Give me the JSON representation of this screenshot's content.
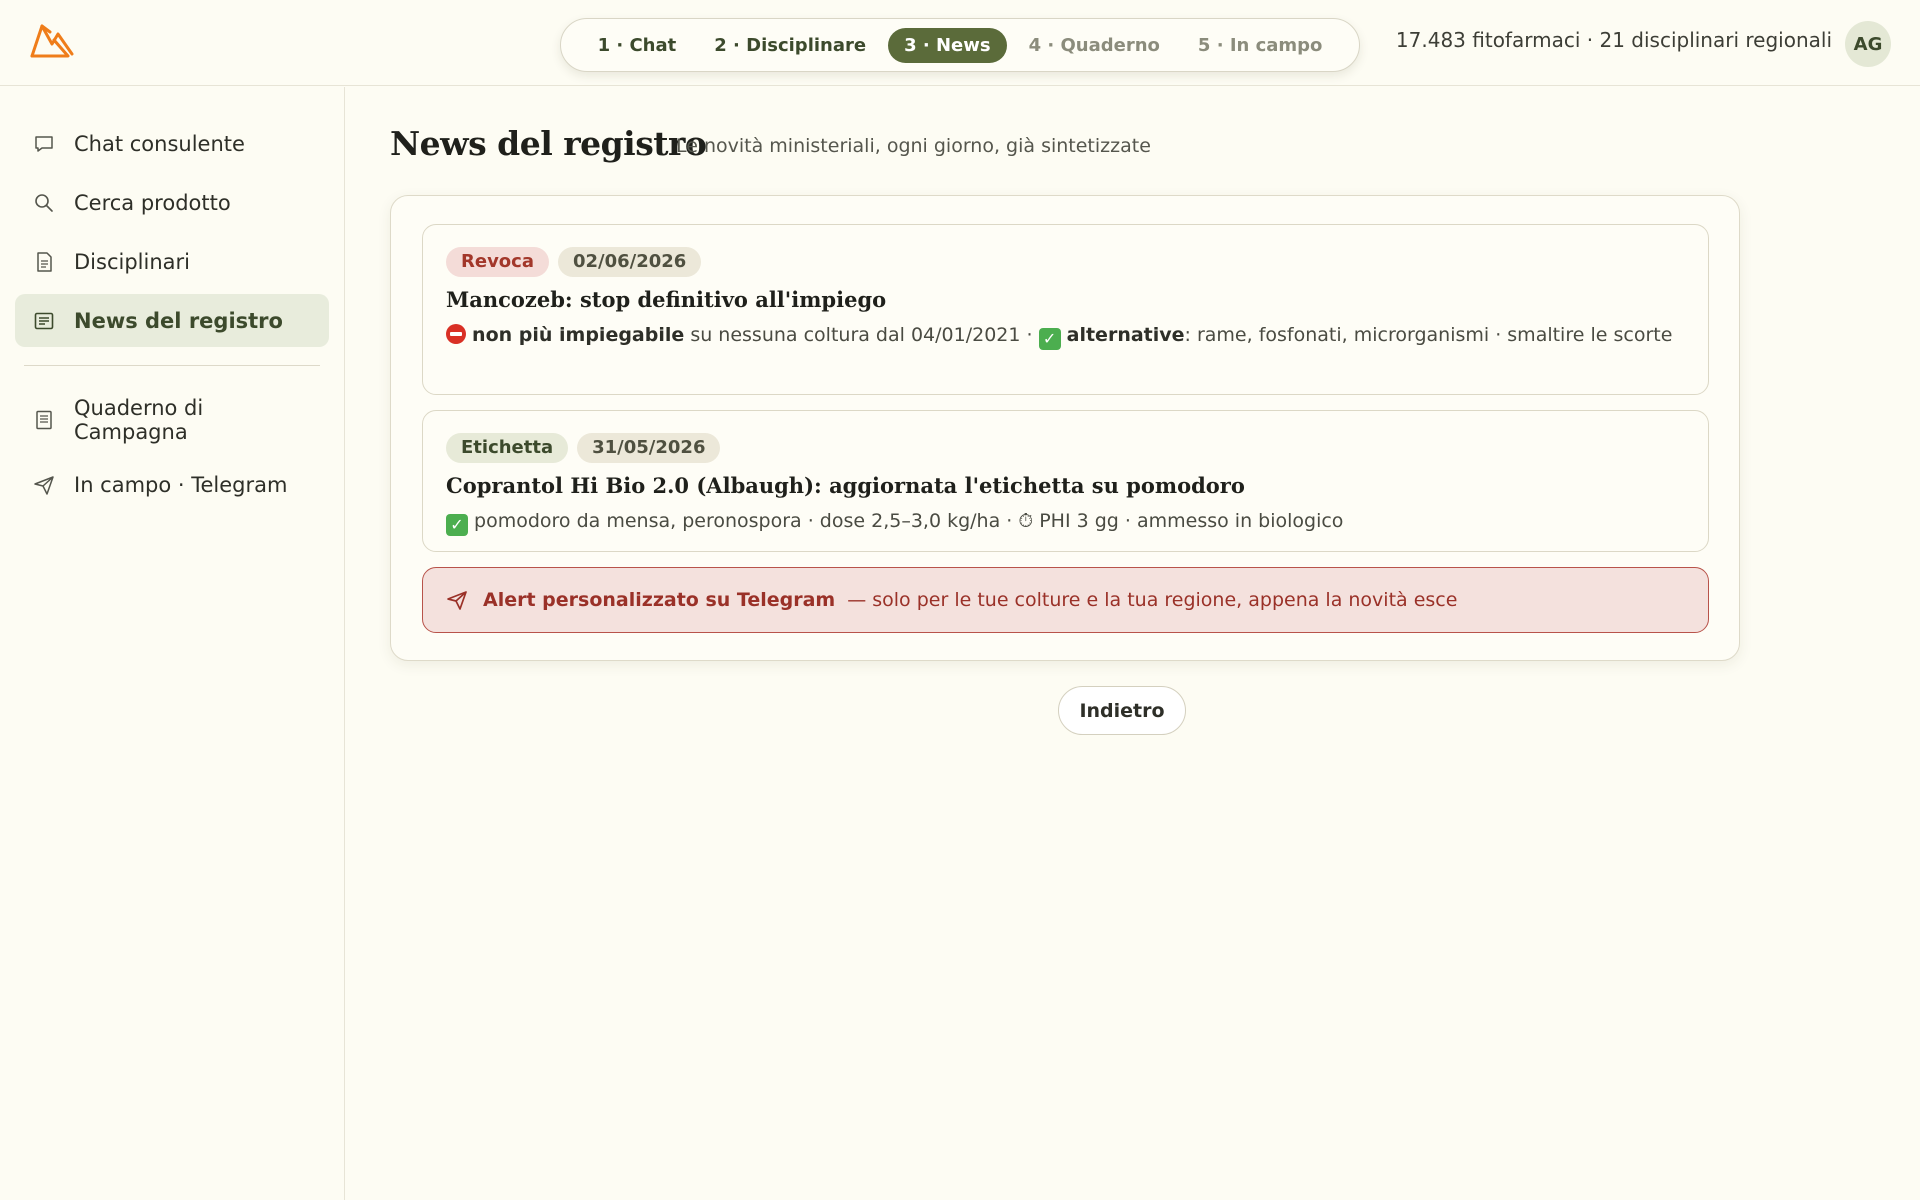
{
  "header": {
    "logo_icon": "mountain-logo-icon",
    "steps": [
      {
        "label": "1 · Chat",
        "state": "done"
      },
      {
        "label": "2 · Disciplinare",
        "state": "done"
      },
      {
        "label": "3 · News",
        "state": "active"
      },
      {
        "label": "4 · Quaderno",
        "state": "future"
      },
      {
        "label": "5 · In campo",
        "state": "future"
      }
    ],
    "stats": "17.483 fitofarmaci · 21 disciplinari regionali",
    "avatar": "AG"
  },
  "sidebar": {
    "items": [
      {
        "label": "Chat consulente",
        "icon": "chat-bubble-icon"
      },
      {
        "label": "Cerca prodotto",
        "icon": "search-icon"
      },
      {
        "label": "Disciplinari",
        "icon": "document-icon"
      },
      {
        "label": "News del registro",
        "icon": "newspaper-icon",
        "active": true
      },
      {
        "label": "Quaderno di Campagna",
        "icon": "notebook-icon"
      },
      {
        "label": "In campo · Telegram",
        "icon": "telegram-send-icon"
      }
    ]
  },
  "main": {
    "title": "News del registro",
    "subtitle": "Le novità ministeriali, ogni giorno, già sintetizzate",
    "news": [
      {
        "tag": "Revoca",
        "date": "02/06/2026",
        "title": "Mancozeb: stop definitivo all'impiego",
        "strong1": "non più impiegabile",
        "text1": " su nessuna coltura dal 04/01/2021 · ",
        "strong2": "alternative",
        "text2": ": rame, fosfonati, microrganismi · smaltire le scorte"
      },
      {
        "tag": "Etichetta",
        "date": "31/05/2026",
        "title": "Coprantol Hi Bio 2.0 (Albaugh): aggiornata l'etichetta su pomodoro",
        "text1": " pomodoro da mensa, peronospora · dose 2,5–3,0 kg/ha · ",
        "timer": "⏱",
        "text2": " PHI 3 gg · ammesso in biologico"
      }
    ],
    "alert": {
      "icon": "telegram-send-icon",
      "strong": "Alert personalizzato su Telegram",
      "rest": "— solo per le tue colture e la tua regione, appena la novità esce"
    },
    "back_label": "Indietro"
  },
  "colors": {
    "accent": "#5b6b3a",
    "revoca": "#a2372a",
    "alert_bg": "#f4e1dd",
    "logo": "#ef7d1a"
  }
}
